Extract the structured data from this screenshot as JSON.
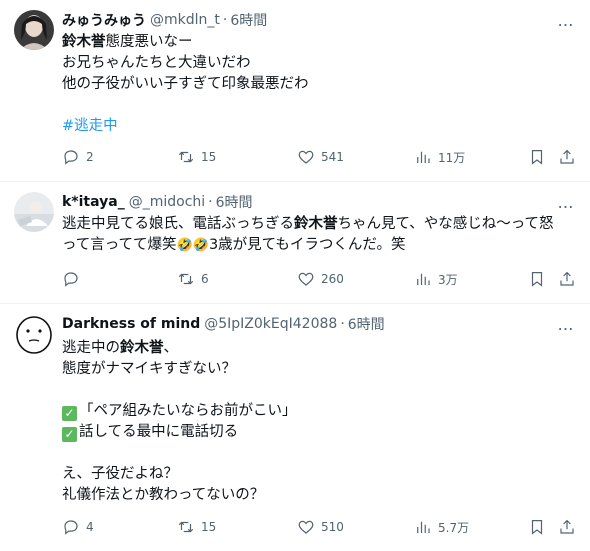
{
  "tweets": [
    {
      "name": "みゅうみゅう",
      "handle": "@mkdln_t",
      "dot": "·",
      "time": "6時間",
      "more": "…",
      "lines": {
        "l1_bold": "鈴木誉",
        "l1_rest": "態度悪いなー",
        "l2": "お兄ちゃんたちと大違いだわ",
        "l3": "他の子役がいい子すぎて印象最悪だわ",
        "hashtag": "#逃走中"
      },
      "stats": {
        "replies": "2",
        "reposts": "15",
        "likes": "541",
        "views": "11万"
      }
    },
    {
      "name": "k*itaya_",
      "handle": "@_midochi",
      "dot": "·",
      "time": "6時間",
      "more": "…",
      "lines": {
        "l1_a": "逃走中見てる娘氏、電話ぶっちぎる",
        "l1_bold": "鈴木誉",
        "l1_b": "ちゃん見て、やな感じね〜って怒",
        "l2_a": "って言ってて爆笑",
        "emoji": "🤣🤣",
        "l2_b": "3歳が見てもイラつくんだ。笑"
      },
      "stats": {
        "replies": "",
        "reposts": "6",
        "likes": "260",
        "views": "3万"
      }
    },
    {
      "name": "Darkness of mind",
      "handle": "@5IpIZ0kEqI42088",
      "dot": "·",
      "time": "6時間",
      "more": "…",
      "lines": {
        "l1_a": "逃走中の",
        "l1_bold": "鈴木誉",
        "l1_b": "、",
        "l2": "態度がナマイキすぎない？",
        "l3": "「ペア組みたいならお前がこい」",
        "l4": "話してる最中に電話切る",
        "l5": "え、子役だよね？",
        "l6": "礼儀作法とか教わってないの？"
      },
      "stats": {
        "replies": "4",
        "reposts": "15",
        "likes": "510",
        "views": "5.7万"
      }
    }
  ],
  "colors": {
    "text": "#0f1419",
    "secondary": "#536471",
    "link": "#1d9bf0",
    "divider": "#eff3f4",
    "checkmark": "#5cb85c"
  },
  "icons": {
    "reply": "reply-icon",
    "repost": "repost-icon",
    "like": "heart-icon",
    "views": "views-chart-icon",
    "bookmark": "bookmark-icon",
    "share": "share-icon",
    "check": "check-box-emoji"
  }
}
